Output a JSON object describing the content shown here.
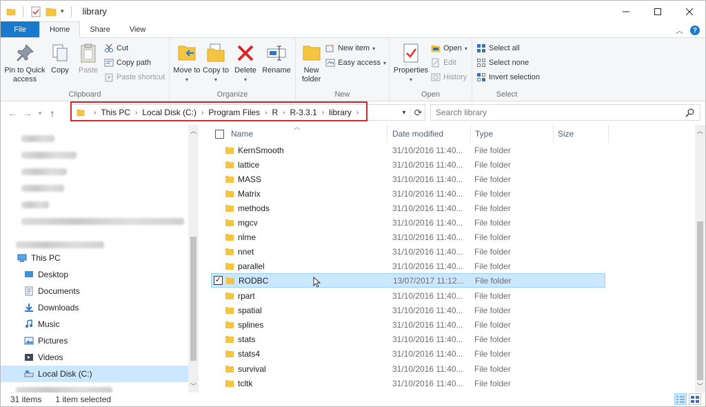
{
  "window": {
    "title": "library",
    "controls": [
      "minimize-icon",
      "maximize-icon",
      "close-icon"
    ]
  },
  "ribbon_tabs": [
    {
      "label": "File"
    },
    {
      "label": "Home"
    },
    {
      "label": "Share"
    },
    {
      "label": "View"
    }
  ],
  "ribbon": {
    "clipboard": {
      "label": "Clipboard",
      "pin_to_quick_access": "Pin to Quick access",
      "copy": "Copy",
      "paste": "Paste",
      "cut": "Cut",
      "copy_path": "Copy path",
      "paste_shortcut": "Paste shortcut"
    },
    "organize": {
      "label": "Organize",
      "move_to": "Move to",
      "copy_to": "Copy to",
      "delete": "Delete",
      "rename": "Rename"
    },
    "new": {
      "label": "New",
      "new_folder": "New folder",
      "new_item": "New item",
      "easy_access": "Easy access"
    },
    "open": {
      "label": "Open",
      "properties": "Properties",
      "open": "Open",
      "edit": "Edit",
      "history": "History"
    },
    "select": {
      "label": "Select",
      "select_all": "Select all",
      "select_none": "Select none",
      "invert_selection": "Invert selection"
    }
  },
  "address": {
    "breadcrumbs": [
      "This PC",
      "Local Disk (C:)",
      "Program Files",
      "R",
      "R-3.3.1",
      "library"
    ],
    "search_placeholder": "Search library"
  },
  "nav_pane": {
    "this_pc": "This PC",
    "items": [
      "Desktop",
      "Documents",
      "Downloads",
      "Music",
      "Pictures",
      "Videos",
      "Local Disk (C:)"
    ]
  },
  "columns": {
    "name": "Name",
    "date_modified": "Date modified",
    "type": "Type",
    "size": "Size"
  },
  "files": [
    {
      "name": "KernSmooth",
      "date": "31/10/2016 11:40...",
      "type": "File folder"
    },
    {
      "name": "lattice",
      "date": "31/10/2016 11:40...",
      "type": "File folder"
    },
    {
      "name": "MASS",
      "date": "31/10/2016 11:40...",
      "type": "File folder"
    },
    {
      "name": "Matrix",
      "date": "31/10/2016 11:40...",
      "type": "File folder"
    },
    {
      "name": "methods",
      "date": "31/10/2016 11:40...",
      "type": "File folder"
    },
    {
      "name": "mgcv",
      "date": "31/10/2016 11:40...",
      "type": "File folder"
    },
    {
      "name": "nlme",
      "date": "31/10/2016 11:40...",
      "type": "File folder"
    },
    {
      "name": "nnet",
      "date": "31/10/2016 11:40...",
      "type": "File folder"
    },
    {
      "name": "parallel",
      "date": "31/10/2016 11:40...",
      "type": "File folder"
    },
    {
      "name": "RODBC",
      "date": "13/07/2017 11:12...",
      "type": "File folder",
      "selected": true
    },
    {
      "name": "rpart",
      "date": "31/10/2016 11:40...",
      "type": "File folder"
    },
    {
      "name": "spatial",
      "date": "31/10/2016 11:40...",
      "type": "File folder"
    },
    {
      "name": "splines",
      "date": "31/10/2016 11:40...",
      "type": "File folder"
    },
    {
      "name": "stats",
      "date": "31/10/2016 11:40...",
      "type": "File folder"
    },
    {
      "name": "stats4",
      "date": "31/10/2016 11:40...",
      "type": "File folder"
    },
    {
      "name": "survival",
      "date": "31/10/2016 11:40...",
      "type": "File folder"
    },
    {
      "name": "tcltk",
      "date": "31/10/2016 11:40...",
      "type": "File folder"
    }
  ],
  "status": {
    "item_count": "31 items",
    "selection": "1 item selected"
  },
  "colors": {
    "accent": "#1979ca",
    "selection": "#cce8ff",
    "highlight_box": "#d9252c",
    "folder": "#f5c542"
  }
}
